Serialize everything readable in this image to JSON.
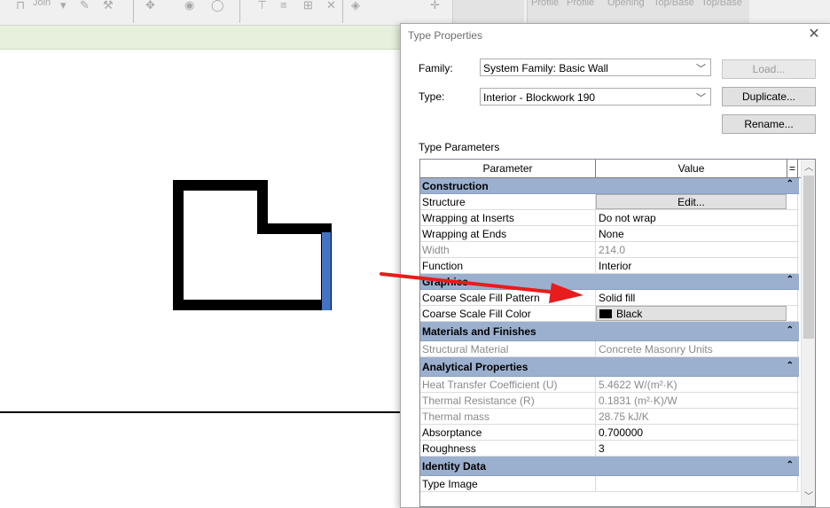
{
  "ribbon": {
    "join_label": "Join",
    "profile_1": "Profile",
    "profile_2": "Profile",
    "opening": "Opening",
    "top_base_1": "Top/Base",
    "top_base_2": "Top/Base"
  },
  "dialog": {
    "title": "Type Properties",
    "family_label": "Family:",
    "family_value": "System Family: Basic Wall",
    "type_label": "Type:",
    "type_value": "Interior - Blockwork 190",
    "load_button": "Load...",
    "duplicate_button": "Duplicate...",
    "rename_button": "Rename...",
    "type_parameters_label": "Type Parameters",
    "col_parameter": "Parameter",
    "col_value": "Value",
    "col_eq": "=",
    "groups": [
      {
        "name": "Construction",
        "rows": [
          {
            "param": "Structure",
            "value": "Edit...",
            "kind": "button"
          },
          {
            "param": "Wrapping at Inserts",
            "value": "Do not wrap"
          },
          {
            "param": "Wrapping at Ends",
            "value": "None"
          },
          {
            "param": "Width",
            "value": "214.0",
            "readonly": true
          },
          {
            "param": "Function",
            "value": "Interior"
          }
        ]
      },
      {
        "name": "Graphics",
        "rows": [
          {
            "param": "Coarse Scale Fill Pattern",
            "value": "Solid fill"
          },
          {
            "param": "Coarse Scale Fill Color",
            "value": "Black",
            "kind": "color"
          }
        ]
      },
      {
        "name": "Materials and Finishes",
        "rows": [
          {
            "param": "Structural Material",
            "value": "Concrete Masonry Units",
            "readonly": true
          }
        ]
      },
      {
        "name": "Analytical Properties",
        "rows": [
          {
            "param": "Heat Transfer Coefficient (U)",
            "value": "5.4622 W/(m²·K)",
            "readonly": true
          },
          {
            "param": "Thermal Resistance (R)",
            "value": "0.1831 (m²·K)/W",
            "readonly": true
          },
          {
            "param": "Thermal mass",
            "value": "28.75 kJ/K",
            "readonly": true
          },
          {
            "param": "Absorptance",
            "value": "0.700000"
          },
          {
            "param": "Roughness",
            "value": "3"
          }
        ]
      },
      {
        "name": "Identity Data",
        "rows": [
          {
            "param": "Type Image",
            "value": ""
          }
        ]
      }
    ]
  },
  "colors": {
    "group_header": "#9bb0cf",
    "wall_black": "#000000",
    "selected_wall_blue": "#4472c4",
    "annotation_arrow": "#e81c1c",
    "options_bar": "#e7f0dd"
  }
}
